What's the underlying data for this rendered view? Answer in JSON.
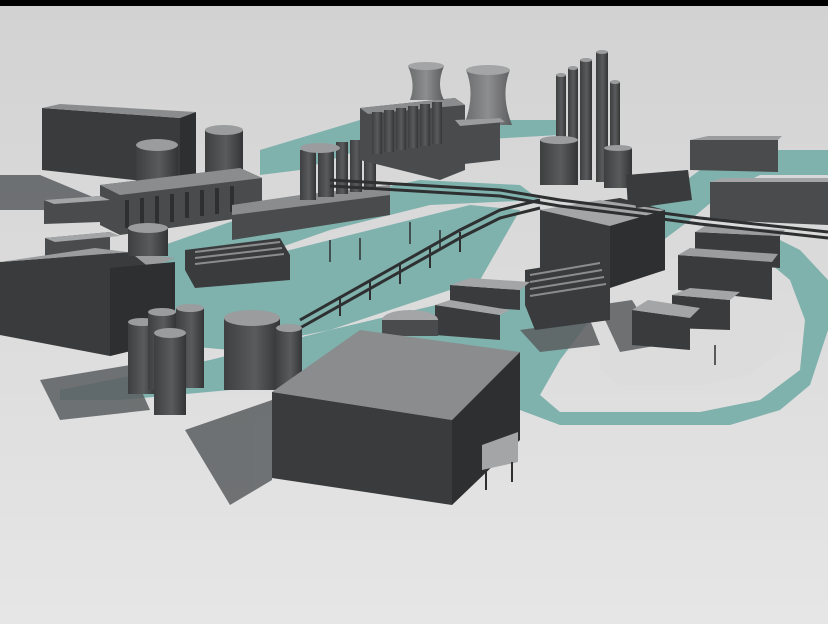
{
  "scene": {
    "kind": "3d-render",
    "subject": "industrial-plant",
    "colors": {
      "top_border": "#000000",
      "ground": "#d9d9d9",
      "ground_light": "#e4e4e4",
      "road": "#7fb1ad",
      "road_edge": "#6c9c98",
      "shadow": "#5b5e60",
      "wall_dark": "#3a3b3c",
      "wall_mid": "#4a4b4c",
      "roof": "#8a8c8d",
      "roof_light": "#a3a5a6",
      "tank_side": "#4c4d4e",
      "tank_top": "#9a9c9d",
      "structure": "#2e2f30"
    }
  }
}
